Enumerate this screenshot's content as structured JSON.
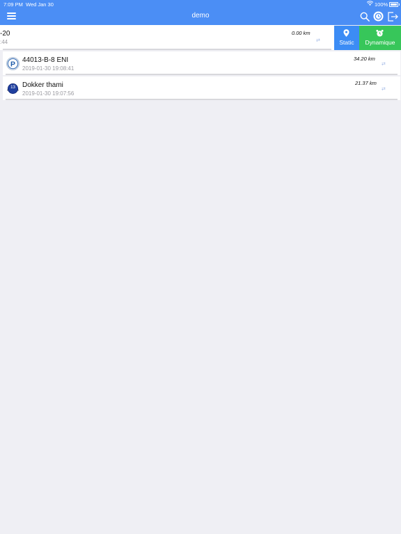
{
  "status_bar": {
    "time": "7:09 PM",
    "date": "Wed Jan 30",
    "battery": "100%"
  },
  "nav": {
    "title": "demo"
  },
  "rows": [
    {
      "name": "-20",
      "timestamp": ":44",
      "distance": "0.00 km",
      "swipe_actions": {
        "static_label": "Static",
        "dynamic_label": "Dynamique"
      }
    },
    {
      "name": "44013-B-8 ENI",
      "timestamp": "2019-01-30 19:08:41",
      "distance": "34.20 km",
      "icon": "parking-icon"
    },
    {
      "name": "Dokker thami",
      "timestamp": "2019-01-30 19:07:56",
      "distance": "21.37 km",
      "icon": "vehicle-badge-icon",
      "badge": "13"
    }
  ],
  "colors": {
    "primary": "#4b8ef5",
    "static_button": "#3c8cf5",
    "dynamic_button": "#37c65a",
    "background": "#efeff4"
  }
}
